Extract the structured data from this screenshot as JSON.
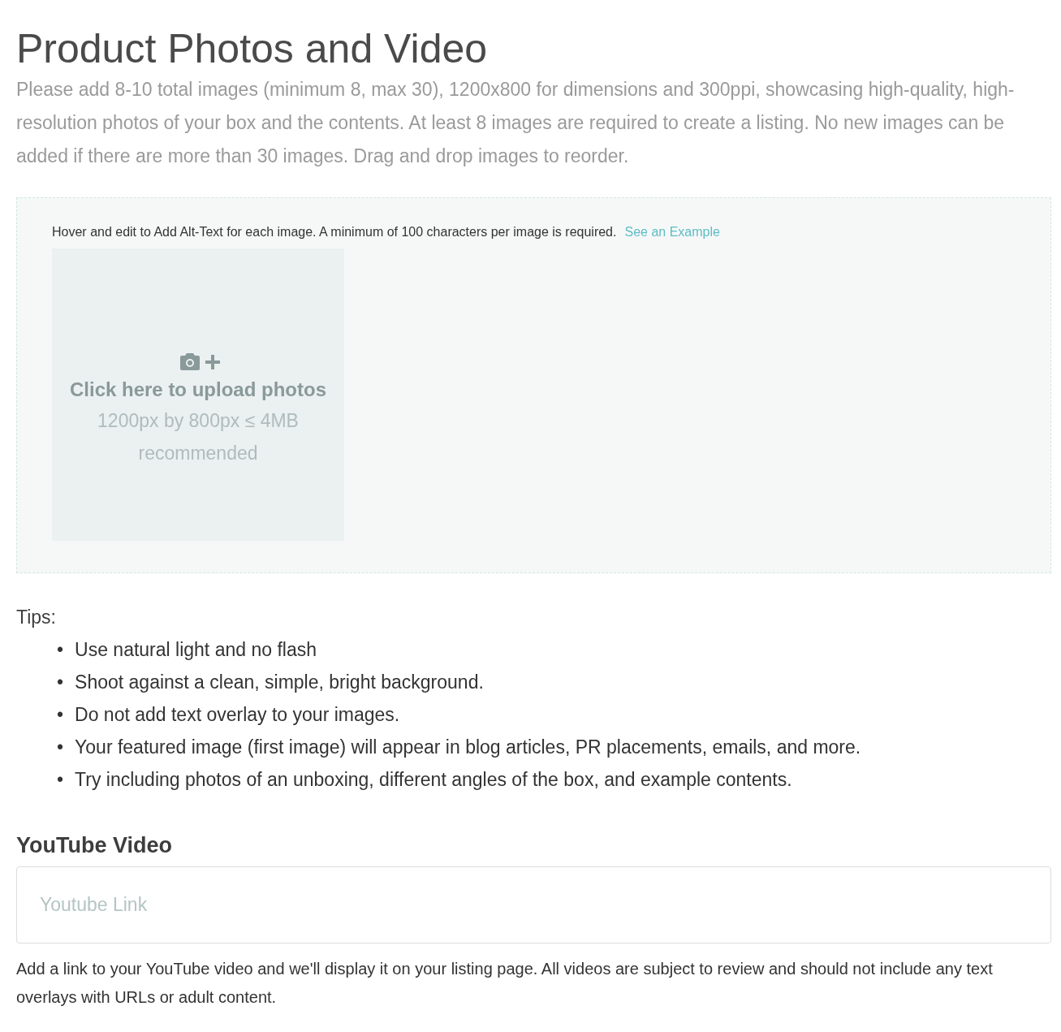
{
  "title": "Product Photos and Video",
  "description": "Please add 8-10 total images (minimum 8, max 30), 1200x800 for dimensions and 300ppi, showcasing high-quality, high-resolution photos of your box and the contents. At least 8 images are required to create a listing. No new images can be added if there are more than 30 images. Drag and drop images to reorder.",
  "upload_area": {
    "instruction": "Hover and edit to Add Alt-Text for each image. A minimum of 100 characters per image is required.",
    "example_link": "See an Example",
    "upload_tile": {
      "title": "Click here to upload photos",
      "hint": "1200px by 800px ≤ 4MB recommended"
    }
  },
  "tips": {
    "label": "Tips:",
    "marker": "•",
    "items": [
      "Use natural light and no flash",
      "Shoot against a clean, simple, bright background.",
      "Do not add text overlay to your images.",
      "Your featured image (first image) will appear in blog articles, PR placements, emails, and more.",
      "Try including photos of an unboxing, different angles of the box, and example contents."
    ]
  },
  "youtube": {
    "heading": "YouTube Video",
    "placeholder": "Youtube Link",
    "help": "Add a link to your YouTube video and we'll display it on your listing page. All videos are subject to review and should not include any text overlays with URLs or adult content."
  }
}
